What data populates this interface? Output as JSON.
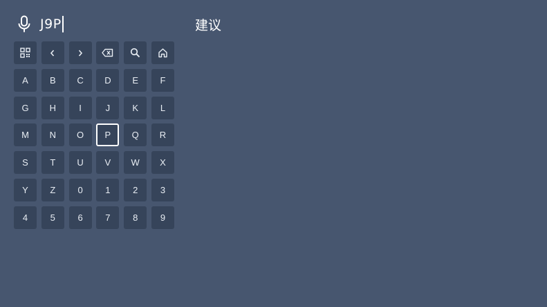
{
  "search": {
    "query": "J9P"
  },
  "suggestions": {
    "title": "建议"
  },
  "keyboard": {
    "tools": [
      {
        "name": "qr-code",
        "icon": "qr-code-icon"
      },
      {
        "name": "cursor-left",
        "icon": "chevron-left-icon"
      },
      {
        "name": "cursor-right",
        "icon": "chevron-right-icon"
      },
      {
        "name": "backspace",
        "icon": "backspace-icon"
      },
      {
        "name": "search",
        "icon": "search-icon"
      },
      {
        "name": "home",
        "icon": "home-icon"
      }
    ],
    "keys": [
      "A",
      "B",
      "C",
      "D",
      "E",
      "F",
      "G",
      "H",
      "I",
      "J",
      "K",
      "L",
      "M",
      "N",
      "O",
      "P",
      "Q",
      "R",
      "S",
      "T",
      "U",
      "V",
      "W",
      "X",
      "Y",
      "Z",
      "0",
      "1",
      "2",
      "3",
      "4",
      "5",
      "6",
      "7",
      "8",
      "9"
    ],
    "focused_key": "P"
  },
  "colors": {
    "background": "#47566f",
    "key_background": "#36445a",
    "focus_border": "#ffffff"
  }
}
